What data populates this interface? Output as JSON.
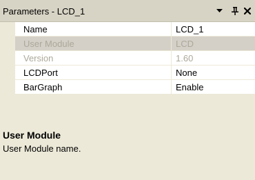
{
  "panel": {
    "title": "Parameters - LCD_1"
  },
  "icons": {
    "dropdown": "chevron-down-icon",
    "pin": "pin-icon",
    "close": "close-icon"
  },
  "properties": [
    {
      "name": "Name",
      "value": "LCD_1",
      "readonly": false
    },
    {
      "name": "User Module",
      "value": "LCD",
      "readonly": true
    },
    {
      "name": "Version",
      "value": "1.60",
      "readonly": true
    },
    {
      "name": "LCDPort",
      "value": "None",
      "readonly": false
    },
    {
      "name": "BarGraph",
      "value": "Enable",
      "readonly": false
    }
  ],
  "help": {
    "title": "User Module",
    "description": "User Module name."
  },
  "colors": {
    "title_bar": "#d8d4c5",
    "gutter": "#ece9d8",
    "readonly_text": "#aca899",
    "selected_row": "#d4d0c8"
  }
}
